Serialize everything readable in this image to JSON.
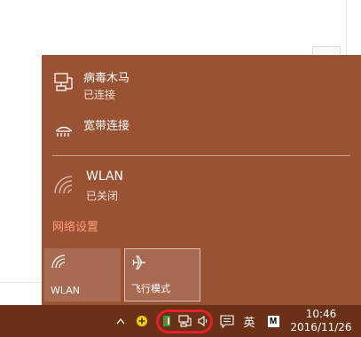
{
  "network_flyout": {
    "items": [
      {
        "name": "病毒木马",
        "status": "已连接",
        "icon": "ethernet-icon"
      },
      {
        "name": "宽带连接",
        "status": "",
        "icon": "dialup-icon"
      },
      {
        "name": "WLAN",
        "status": "已关闭",
        "icon": "wifi-icon"
      }
    ],
    "settings_link": "网络设置",
    "tiles": [
      {
        "label": "WLAN",
        "icon": "wifi-icon"
      },
      {
        "label": "飞行模式",
        "icon": "airplane-icon"
      }
    ]
  },
  "taskbar": {
    "ime_label": "英",
    "ime_mode": "M",
    "time": "10:46",
    "date": "2016/11/26"
  },
  "colors": {
    "accent": "#9a5234",
    "taskbar": "#6b3116",
    "link": "#ff9e76",
    "highlight_ring": "#e8202b"
  }
}
